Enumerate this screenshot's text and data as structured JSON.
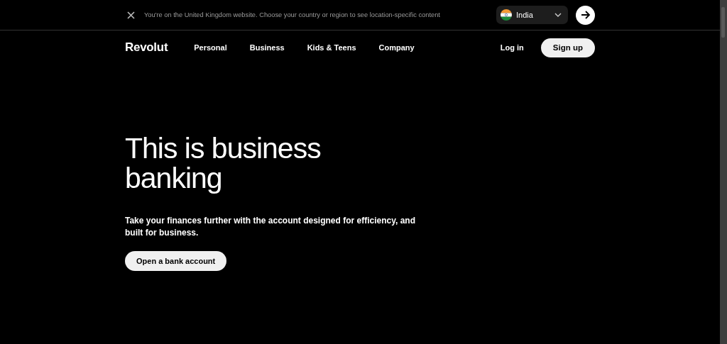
{
  "banner": {
    "message": "You're on the United Kingdom website. Choose your country or region to see location-specific content",
    "country": "India"
  },
  "nav": {
    "logo": "Revolut",
    "links": [
      "Personal",
      "Business",
      "Kids & Teens",
      "Company"
    ],
    "login": "Log in",
    "signup": "Sign up"
  },
  "hero": {
    "title": "This is business banking",
    "subtitle": "Take your finances further with the account designed for efficiency, and built for business.",
    "cta": "Open a bank account"
  }
}
